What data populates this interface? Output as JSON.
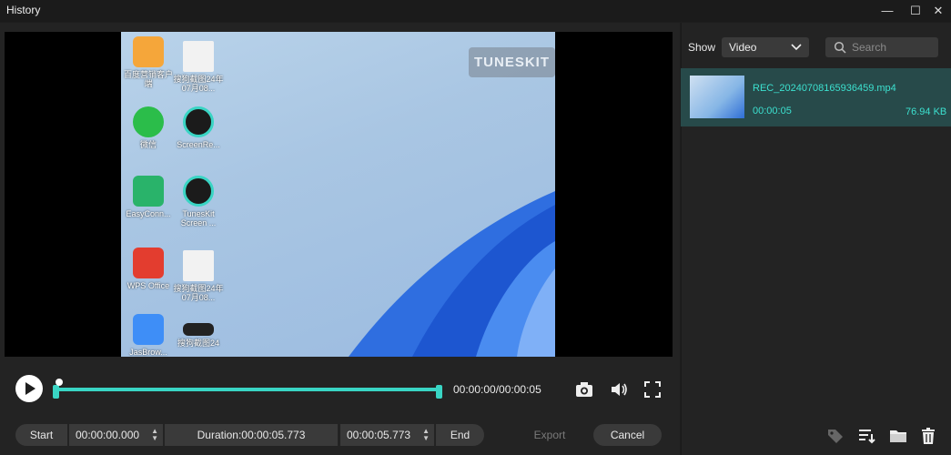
{
  "window": {
    "title": "History"
  },
  "preview": {
    "watermark": "TUNESKIT",
    "desktop_icons": [
      {
        "label": "百度营销客户端"
      },
      {
        "label": "搜狗截图24年07月08..."
      },
      {
        "label": "微信"
      },
      {
        "label": "ScreenRe..."
      },
      {
        "label": "EasyConn..."
      },
      {
        "label": "TunesKit Screen ..."
      },
      {
        "label": "WPS Office"
      },
      {
        "label": "搜狗截图24年07月08..."
      },
      {
        "label": "JasBrow..."
      },
      {
        "label": "搜狗截图24"
      }
    ]
  },
  "playback": {
    "timecode": "00:00:00/00:00:05",
    "progress": 0.0
  },
  "trim": {
    "start_label": "Start",
    "start_time": "00:00:00.000",
    "duration": "Duration:00:00:05.773",
    "end_time": "00:00:05.773",
    "end_label": "End"
  },
  "actions": {
    "export_label": "Export",
    "cancel_label": "Cancel"
  },
  "history": {
    "show_label": "Show",
    "filter_value": "Video",
    "search_placeholder": "Search",
    "items": [
      {
        "filename": "REC_20240708165936459.mp4",
        "duration": "00:00:05",
        "size": "76.94 KB"
      }
    ]
  },
  "colors": {
    "accent": "#39d5c4",
    "selected_bg": "#274a4a",
    "background": "#1e1e1e"
  }
}
